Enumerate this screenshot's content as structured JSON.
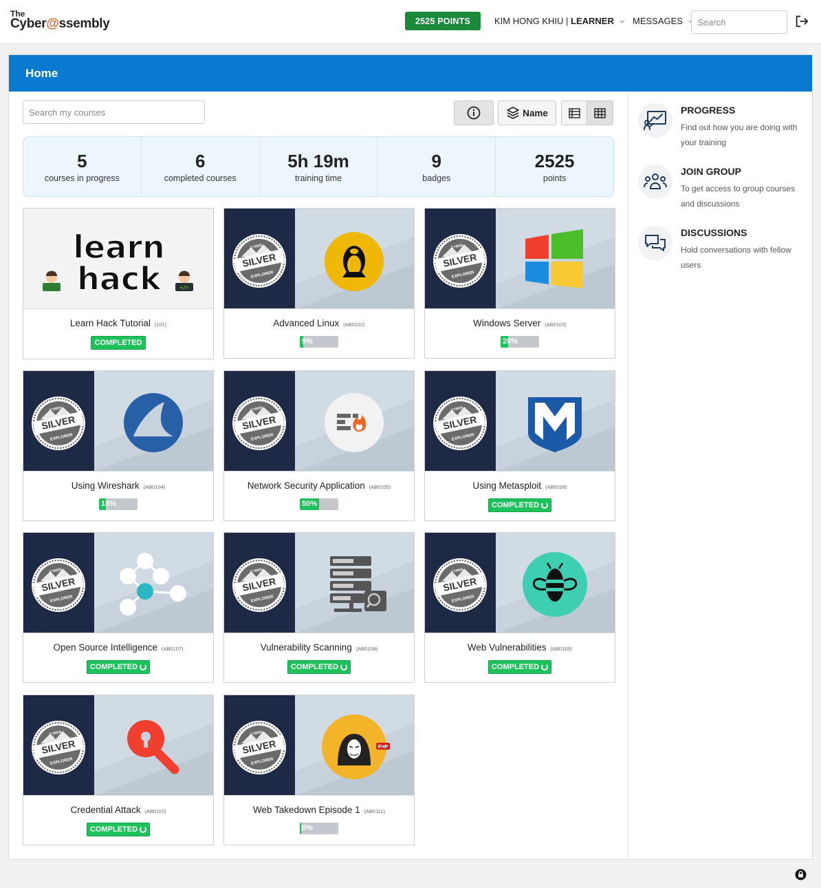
{
  "header": {
    "logo_the": "The",
    "logo_name_a": "Cyber",
    "logo_at": "@",
    "logo_name_b": "ssembly",
    "points_label": "2525 POINTS",
    "user_name": "KIM HONG KHIU",
    "user_separator": " | ",
    "user_role": "LEARNER",
    "messages_label": "MESSAGES",
    "search_placeholder": "Search",
    "accent_color": "#1a8a3a"
  },
  "page": {
    "title": "Home",
    "header_color": "#0a7ad1",
    "course_search_placeholder": "Search my courses",
    "sort_label": "Name"
  },
  "stats": [
    {
      "value": "5",
      "label": "courses in progress"
    },
    {
      "value": "6",
      "label": "completed courses"
    },
    {
      "value": "5h 19m",
      "label": "training time"
    },
    {
      "value": "9",
      "label": "badges"
    },
    {
      "value": "2525",
      "label": "points"
    }
  ],
  "courses": [
    {
      "title": "Learn Hack Tutorial",
      "code": "(101)",
      "status": "completed",
      "status_label": "COMPLETED",
      "icon": "learn-hack-logo",
      "cover_text_a": "learn",
      "cover_text_b": "hack"
    },
    {
      "title": "Advanced Linux",
      "code": "(AB0102)",
      "status": "progress",
      "progress": 9,
      "progress_label": "9%",
      "icon": "linux-tux-icon"
    },
    {
      "title": "Windows Server",
      "code": "(AB0103)",
      "status": "progress",
      "progress": 20,
      "progress_label": "20%",
      "icon": "windows-logo-icon"
    },
    {
      "title": "Using Wireshark",
      "code": "(AB0104)",
      "status": "progress",
      "progress": 18,
      "progress_label": "18%",
      "icon": "wireshark-icon"
    },
    {
      "title": "Network Security Application",
      "code": "(AB0105)",
      "status": "progress",
      "progress": 50,
      "progress_label": "50%",
      "icon": "firewall-icon"
    },
    {
      "title": "Using Metasploit",
      "code": "(AB0106)",
      "status": "completed",
      "status_label": "COMPLETED",
      "icon": "metasploit-icon"
    },
    {
      "title": "Open Source Intelligence",
      "code": "(AB0107)",
      "status": "completed",
      "status_label": "COMPLETED",
      "icon": "network-nodes-icon"
    },
    {
      "title": "Vulnerability Scanning",
      "code": "(AB0108)",
      "status": "completed",
      "status_label": "COMPLETED",
      "icon": "server-scan-icon"
    },
    {
      "title": "Web Vulnerabilities",
      "code": "(AB0109)",
      "status": "completed",
      "status_label": "COMPLETED",
      "icon": "bug-bee-icon"
    },
    {
      "title": "Credential Attack",
      "code": "(AB0110)",
      "status": "completed",
      "status_label": "COMPLETED",
      "icon": "key-magnifier-icon"
    },
    {
      "title": "Web Takedown Episode 1",
      "code": "(AB0111)",
      "status": "progress",
      "progress": 0,
      "progress_label": "0%",
      "icon": "anonymous-php-icon",
      "icon_tag": "PHP"
    }
  ],
  "badge_seal": {
    "top": "CYBER",
    "main": "SILVER",
    "bottom": "EXPLORER"
  },
  "sidebar": [
    {
      "title": "PROGRESS",
      "desc": "Find out how you are doing with your training",
      "icon": "progress-chart-icon"
    },
    {
      "title": "JOIN GROUP",
      "desc": "To get access to group courses and discussions",
      "icon": "group-people-icon"
    },
    {
      "title": "DISCUSSIONS",
      "desc": "Hold conversations with fellow users",
      "icon": "chat-bubbles-icon"
    }
  ]
}
